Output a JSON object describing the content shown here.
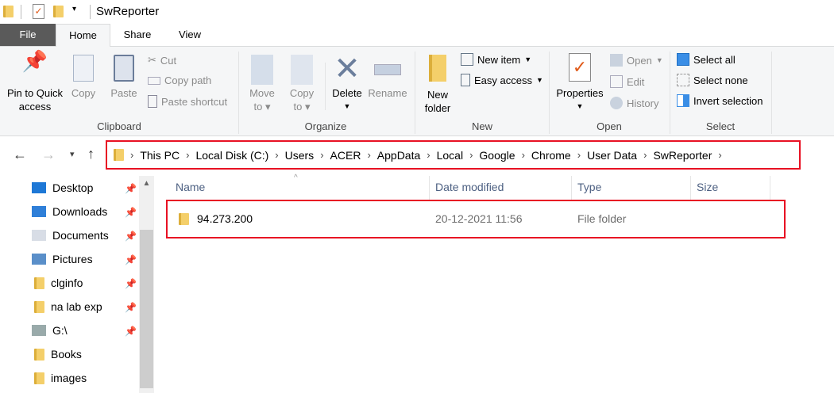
{
  "title": "SwReporter",
  "tabs": [
    "File",
    "Home",
    "Share",
    "View"
  ],
  "clipboard": {
    "pin": "Pin to Quick access",
    "pin1": "Pin to Quick",
    "pin2": "access",
    "copy": "Copy",
    "paste": "Paste",
    "cut": "Cut",
    "copy_path": "Copy path",
    "paste_shortcut": "Paste shortcut",
    "label": "Clipboard"
  },
  "organize": {
    "move1": "Move",
    "move2": "to",
    "copy1": "Copy",
    "copy2": "to",
    "delete": "Delete",
    "rename": "Rename",
    "label": "Organize"
  },
  "new": {
    "new1": "New",
    "new2": "folder",
    "new_item": "New item",
    "easy_access": "Easy access",
    "label": "New"
  },
  "open": {
    "properties": "Properties",
    "open": "Open",
    "edit": "Edit",
    "history": "History",
    "label": "Open"
  },
  "select": {
    "all": "Select all",
    "none": "Select none",
    "invert": "Invert selection",
    "label": "Select"
  },
  "breadcrumb": [
    "This PC",
    "Local Disk (C:)",
    "Users",
    "ACER",
    "AppData",
    "Local",
    "Google",
    "Chrome",
    "User Data",
    "SwReporter"
  ],
  "sidebar": [
    "Desktop",
    "Downloads",
    "Documents",
    "Pictures",
    "clginfo",
    "na lab exp",
    "G:\\",
    "Books",
    "images"
  ],
  "columns": [
    "Name",
    "Date modified",
    "Type",
    "Size"
  ],
  "rows": [
    {
      "name": "94.273.200",
      "date": "20-12-2021 11:56",
      "type": "File folder",
      "size": ""
    }
  ],
  "colors": {
    "highlight": "#e81123",
    "file_tab": "#5a5a5a"
  }
}
